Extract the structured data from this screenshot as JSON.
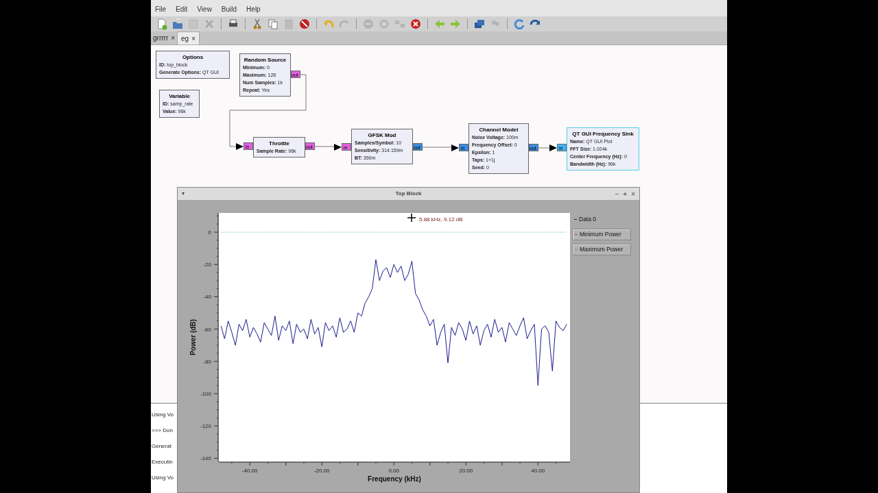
{
  "menu": [
    "File",
    "Edit",
    "View",
    "Build",
    "Help"
  ],
  "toolbar": [
    [
      {
        "disabled": false
      },
      {
        "disabled": false
      },
      {
        "disabled": true
      },
      {
        "disabled": true
      }
    ],
    [
      {
        "disabled": false
      }
    ],
    [
      {
        "disabled": false
      },
      {
        "disabled": false
      },
      {
        "disabled": true
      },
      {
        "disabled": false
      }
    ],
    [
      {
        "disabled": false
      },
      {
        "disabled": true
      }
    ],
    [
      {
        "disabled": true
      },
      {
        "disabled": true
      },
      {
        "disabled": true
      },
      {
        "disabled": false
      }
    ],
    [
      {
        "disabled": false
      },
      {
        "disabled": false
      }
    ],
    [
      {
        "disabled": false
      },
      {
        "disabled": true
      }
    ],
    [
      {
        "disabled": false
      },
      {
        "disabled": false
      }
    ]
  ],
  "tabs": [
    {
      "label": "grrrrr",
      "close": "×",
      "selected": false
    },
    {
      "label": "eg",
      "close": "×",
      "selected": true
    }
  ],
  "flowgraph": {
    "blocks": [
      {
        "title": "Options",
        "selected": false,
        "params": [
          {
            "name": "ID:",
            "value": "top_block"
          },
          {
            "name": "Generate Options:",
            "value": "QT GUI"
          }
        ]
      },
      {
        "title": "Variable",
        "selected": false,
        "params": [
          {
            "name": "ID:",
            "value": "samp_rate"
          },
          {
            "name": "Value:",
            "value": "96k"
          }
        ]
      },
      {
        "title": "Random Source",
        "selected": false,
        "params": [
          {
            "name": "Minimum:",
            "value": "0"
          },
          {
            "name": "Maximum:",
            "value": "128"
          },
          {
            "name": "Num Samples:",
            "value": "1k"
          },
          {
            "name": "Repeat:",
            "value": "Yes"
          }
        ],
        "outputs": [
          {
            "label": "out",
            "color": "#e060e0"
          }
        ]
      },
      {
        "title": "Throttle",
        "selected": false,
        "params": [
          {
            "name": "Sample Rate:",
            "value": "96k"
          }
        ],
        "inputs": [
          {
            "label": "in",
            "color": "#e060e0"
          }
        ],
        "outputs": [
          {
            "label": "out",
            "color": "#e060e0"
          }
        ]
      },
      {
        "title": "GFSK Mod",
        "selected": false,
        "params": [
          {
            "name": "Samples/Symbol:",
            "value": "10"
          },
          {
            "name": "Sensitivity:",
            "value": "314.159m"
          },
          {
            "name": "BT:",
            "value": "350m"
          }
        ],
        "inputs": [
          {
            "label": "in",
            "color": "#e060e0"
          }
        ],
        "outputs": [
          {
            "label": "out",
            "color": "#3a8ee0"
          }
        ]
      },
      {
        "title": "Channel Model",
        "selected": false,
        "params": [
          {
            "name": "Noise Voltage:",
            "value": "100m"
          },
          {
            "name": "Frequency Offset:",
            "value": "0"
          },
          {
            "name": "Epsilon:",
            "value": "1"
          },
          {
            "name": "Taps:",
            "value": "1+1j"
          },
          {
            "name": "Seed:",
            "value": "0"
          }
        ],
        "inputs": [
          {
            "label": "in",
            "color": "#3a8ee0"
          }
        ],
        "outputs": [
          {
            "label": "out",
            "color": "#3a8ee0"
          }
        ]
      },
      {
        "title": "QT GUI Frequency Sink",
        "selected": true,
        "params": [
          {
            "name": "Name:",
            "value": "QT GUI Plot"
          },
          {
            "name": "FFT Size:",
            "value": "1.024k"
          },
          {
            "name": "Center Frequency (Hz):",
            "value": "0"
          },
          {
            "name": "Bandwidth (Hz):",
            "value": "96k"
          }
        ],
        "inputs": [
          {
            "label": "in",
            "color": "#40b4f4"
          }
        ]
      }
    ]
  },
  "console": [
    "Using Vo",
    ">>> Don",
    "Generat",
    "Executin",
    "Using Vo"
  ],
  "plot_window": {
    "title": "Top Block",
    "menu_glyph": "▾",
    "buttons": [
      "−",
      "+",
      "×"
    ],
    "legend": [
      {
        "name": "Data 0",
        "color": "#1a1a8c",
        "hidden": false
      },
      {
        "name": "Minimum Power",
        "color": "#c04040",
        "hidden": true
      },
      {
        "name": "Maximum Power",
        "color": "#40a0a0",
        "hidden": true
      }
    ],
    "chart_data": {
      "type": "line",
      "xlabel": "Frequency (kHz)",
      "ylabel": "Power (dB)",
      "xlim": [
        -48.6,
        48.9
      ],
      "ylim": [
        -142,
        11.9
      ],
      "xticks": [
        {
          "value": -40,
          "label": "-40.00"
        },
        {
          "value": -20,
          "label": "-20.00"
        },
        {
          "value": 0,
          "label": "0.00"
        },
        {
          "value": 20,
          "label": "20.00"
        },
        {
          "value": 40,
          "label": "40.00"
        }
      ],
      "yticks": [
        0,
        -20,
        -40,
        -60,
        -80,
        -100,
        -120,
        -140
      ],
      "x": [
        -48,
        -47,
        -46,
        -45,
        -44,
        -43,
        -42,
        -41,
        -40,
        -39,
        -38,
        -37,
        -36,
        -35,
        -34,
        -33,
        -32,
        -31,
        -30,
        -29,
        -28,
        -27,
        -26,
        -25,
        -24,
        -23,
        -22,
        -21,
        -20,
        -19,
        -18,
        -17,
        -16,
        -15,
        -14,
        -13,
        -12,
        -11,
        -10,
        -9,
        -8,
        -7,
        -6,
        -5,
        -4,
        -3,
        -2,
        -1,
        0,
        1,
        2,
        3,
        4,
        5,
        6,
        7,
        8,
        9,
        10,
        11,
        12,
        13,
        14,
        15,
        16,
        17,
        18,
        19,
        20,
        21,
        22,
        23,
        24,
        25,
        26,
        27,
        28,
        29,
        30,
        31,
        32,
        33,
        34,
        35,
        36,
        37,
        38,
        39,
        40,
        41,
        42,
        43,
        44,
        45,
        46,
        47,
        48
      ],
      "series": [
        {
          "line_style": "solid",
          "color": "#1a1a8c",
          "values": [
            -58,
            -66,
            -55,
            -62,
            -70,
            -57,
            -61,
            -54,
            -65,
            -59,
            -63,
            -68,
            -56,
            -60,
            -64,
            -52,
            -67,
            -58,
            -61,
            -55,
            -69,
            -57,
            -62,
            -60,
            -66,
            -54,
            -63,
            -59,
            -71,
            -56,
            -61,
            -58,
            -65,
            -53,
            -62,
            -60,
            -55,
            -62,
            -50,
            -52,
            -44,
            -40,
            -35,
            -17,
            -30,
            -24,
            -22,
            -28,
            -20,
            -25,
            -21,
            -30,
            -26,
            -18,
            -38,
            -42,
            -48,
            -52,
            -58,
            -54,
            -70,
            -62,
            -57,
            -81,
            -59,
            -64,
            -56,
            -60,
            -67,
            -55,
            -63,
            -58,
            -70,
            -61,
            -57,
            -65,
            -54,
            -62,
            -59,
            -68,
            -56,
            -60,
            -64,
            -58,
            -53,
            -66,
            -61,
            -57,
            -95,
            -60,
            -58,
            -62,
            -86,
            -55,
            -59,
            -61,
            -57
          ]
        },
        {
          "line_style": "dotted",
          "color": "#40a0b0",
          "values": [
            0,
            0,
            0,
            0,
            0,
            0,
            0,
            0,
            0,
            0,
            0,
            0,
            0,
            0,
            0,
            0,
            0,
            0,
            0,
            0,
            0,
            0,
            0,
            0,
            0,
            0,
            0,
            0,
            0,
            0,
            0,
            0,
            0,
            0,
            0,
            0,
            0,
            0,
            0,
            0,
            0,
            0,
            0,
            0,
            0,
            0,
            0,
            0,
            0,
            0,
            0,
            0,
            0,
            0,
            0,
            0,
            0,
            0,
            0,
            0,
            0,
            0,
            0,
            0,
            0,
            0,
            0,
            0,
            0,
            0,
            0,
            0,
            0,
            0,
            0,
            0,
            0,
            0,
            0,
            0,
            0,
            0,
            0,
            0,
            0,
            0,
            0,
            0,
            0,
            0,
            0,
            0,
            0,
            0,
            0,
            0,
            0
          ]
        }
      ],
      "annotations": [
        {
          "text": "5.88 kHz, 9.12 dB"
        }
      ]
    }
  }
}
